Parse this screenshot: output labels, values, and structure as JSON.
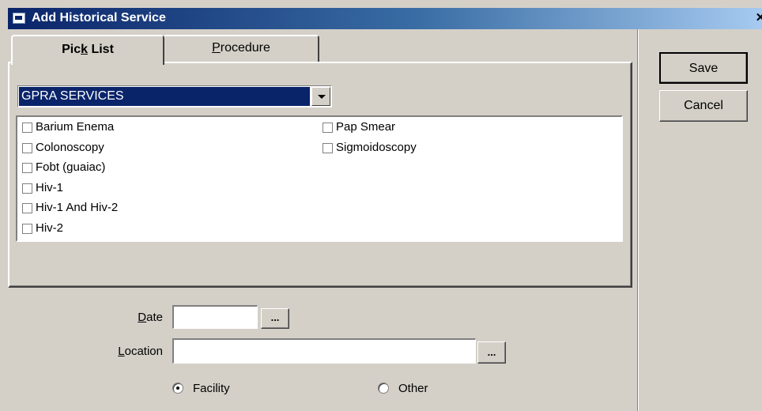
{
  "window": {
    "title": "Add Historical Service",
    "close_glyph": "✕"
  },
  "tabs": [
    {
      "label": "Pick List",
      "accel_index": 3,
      "selected": true
    },
    {
      "label": "Procedure",
      "accel_index": 0,
      "selected": false
    }
  ],
  "picklist": {
    "combo_value": "GPRA SERVICES",
    "items_col1": [
      "Barium Enema",
      "Colonoscopy",
      "Fobt (guaiac)",
      "Hiv-1",
      "Hiv-1 And Hiv-2",
      "Hiv-2"
    ],
    "items_col2": [
      "Pap Smear",
      "Sigmoidoscopy"
    ]
  },
  "buttons": {
    "save": "Save",
    "cancel": "Cancel",
    "ellipsis": "..."
  },
  "form": {
    "date_label_accel": "D",
    "date_label_rest": "ate",
    "date_value": "",
    "location_label_accel": "L",
    "location_label_rest": "ocation",
    "location_value": "",
    "radio_facility": "Facility",
    "radio_other": "Other",
    "selected_radio": "Facility"
  },
  "colors": {
    "face": "#d4d0c8",
    "selection": "#0a246a",
    "title_gradient_start": "#0a246a"
  }
}
